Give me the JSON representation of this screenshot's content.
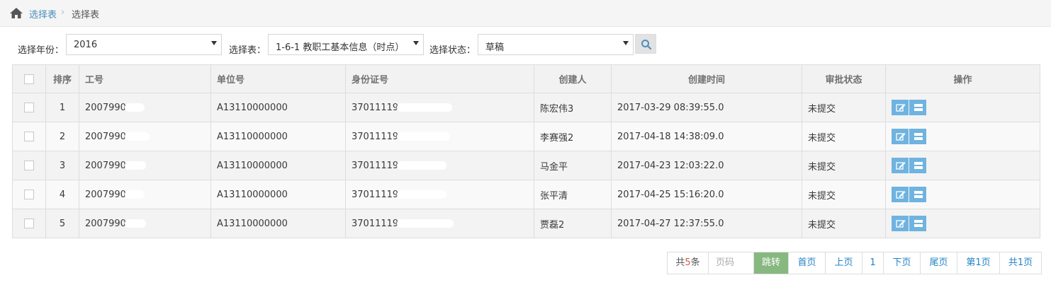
{
  "breadcrumb": {
    "home_icon": "home-icon",
    "link": "选择表",
    "separator": "›",
    "current": "选择表"
  },
  "filters": {
    "year_label": "选择年份：",
    "year_value": "2016",
    "table_label": "选择表：",
    "table_value": "1-6-1 教职工基本信息（时点）",
    "status_label": "选择状态：",
    "status_value": "草稿",
    "search_icon": "search-icon"
  },
  "table": {
    "headers": [
      "",
      "排序",
      "工号",
      "单位号",
      "身份证号",
      "创建人",
      "创建时间",
      "审批状态",
      "操作"
    ],
    "rows": [
      {
        "index": "1",
        "emp_no": "2007990",
        "unit_no": "A13110000000",
        "id_no": "37011119",
        "creator": "陈宏伟3",
        "created": "2017-03-29 08:39:55.0",
        "status": "未提交"
      },
      {
        "index": "2",
        "emp_no": "2007990",
        "unit_no": "A13110000000",
        "id_no": "37011119",
        "creator": "李赛强2",
        "created": "2017-04-18 14:38:09.0",
        "status": "未提交"
      },
      {
        "index": "3",
        "emp_no": "2007990",
        "unit_no": "A13110000000",
        "id_no": "37011119",
        "creator": "马金平",
        "created": "2017-04-23 12:03:22.0",
        "status": "未提交"
      },
      {
        "index": "4",
        "emp_no": "2007990",
        "unit_no": "A13110000000",
        "id_no": "37011119",
        "creator": "张平清",
        "created": "2017-04-25 15:16:20.0",
        "status": "未提交"
      },
      {
        "index": "5",
        "emp_no": "2007990",
        "unit_no": "A13110000000",
        "id_no": "37011119",
        "creator": "贾磊2",
        "created": "2017-04-27 12:37:55.0",
        "status": "未提交"
      }
    ],
    "op_icons": [
      "edit-icon",
      "list-icon"
    ]
  },
  "pager": {
    "total_prefix": "共",
    "total_count": "5",
    "total_suffix": "条",
    "page_input_placeholder": "页码",
    "go": "跳转",
    "first": "首页",
    "prev": "上页",
    "current": "1",
    "next": "下页",
    "last": "尾页",
    "page_of": "第1页",
    "total_pages": "共1页"
  },
  "colors": {
    "link": "#4c8fbd",
    "op_button": "#6fb3e0",
    "go_button": "#87b87f",
    "count_red": "#d15b47"
  }
}
